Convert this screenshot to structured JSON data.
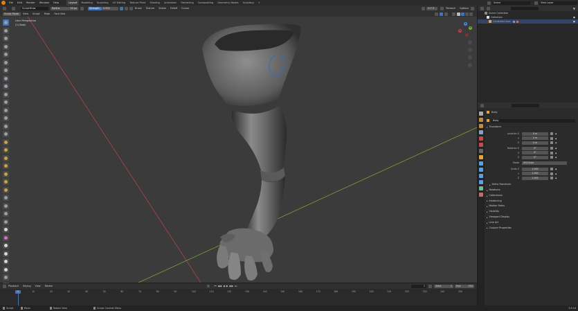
{
  "topbar": {
    "menus": [
      "File",
      "Edit",
      "Render",
      "Window",
      "Help"
    ],
    "workspaces": [
      "Layout",
      "Modeling",
      "Sculpting",
      "UV Editing",
      "Texture Paint",
      "Shading",
      "Animation",
      "Rendering",
      "Compositing",
      "Geometry Nodes",
      "Scripting"
    ],
    "active_workspace": "Layout",
    "scene": "Scene",
    "view_layer": "View Layer"
  },
  "tool_header": {
    "brush_name": "SculptDraw",
    "radius_label": "Radius",
    "radius_value": "50 px",
    "strength_label": "Strength",
    "strength_value": "0.500",
    "menus": [
      "Brush",
      "Texture",
      "Stroke",
      "Falloff",
      "Cursor"
    ],
    "symmetry": "X Y Z",
    "remesh": "Remesh",
    "options": "Options"
  },
  "view_header": {
    "mode": "Sculpt Mode",
    "menus": [
      "View",
      "Sculpt",
      "Mask",
      "Face Sets"
    ]
  },
  "viewport": {
    "perspective_label": "User Perspective",
    "object_label": "(1) Body"
  },
  "outliner": {
    "search_placeholder": "",
    "items": [
      {
        "name": "Scene Collection"
      },
      {
        "name": "Collection"
      },
      {
        "name": "Corrected ruse"
      }
    ]
  },
  "properties": {
    "object_name": "Body",
    "data_name": "Body",
    "sections": {
      "transform": "Transform",
      "location_label": "Location X",
      "rotation_label": "Rotation X",
      "mode_label": "Mode",
      "scale_label": "Scale X",
      "axis_y": "Y",
      "axis_z": "Z",
      "location": [
        "0 m",
        "0 m",
        "0 m"
      ],
      "rotation": [
        "0°",
        "0°",
        "0°"
      ],
      "mode_value": "XYZ Euler",
      "scale": [
        "1.000",
        "1.000",
        "1.000"
      ],
      "delta": "Delta Transform"
    },
    "panels": [
      "Relations",
      "Collections",
      "Instancing",
      "Motion Paths",
      "Visibility",
      "Viewport Display",
      "Line Art",
      "Custom Properties"
    ]
  },
  "timeline": {
    "menus": [
      "Playback",
      "Keying",
      "View",
      "Marker"
    ],
    "current_frame": "1",
    "start_label": "Start",
    "start": "1",
    "end_label": "End",
    "end": "250",
    "ticks": [
      "1",
      "10",
      "20",
      "30",
      "40",
      "50",
      "60",
      "70",
      "80",
      "90",
      "100",
      "110",
      "120",
      "130",
      "140",
      "150",
      "160",
      "170",
      "180",
      "190",
      "200",
      "210",
      "220",
      "230",
      "240",
      "250"
    ]
  },
  "statusbar": {
    "items": [
      "Sculpt",
      "Move",
      "Rotate View",
      "Sculpt Context Menu"
    ],
    "version": "3.6.18"
  },
  "colors": {
    "accent": "#4772b3",
    "x_axis": "#b8414b",
    "y_axis": "#7ba034",
    "brush_circle": "#2f6fbf"
  }
}
